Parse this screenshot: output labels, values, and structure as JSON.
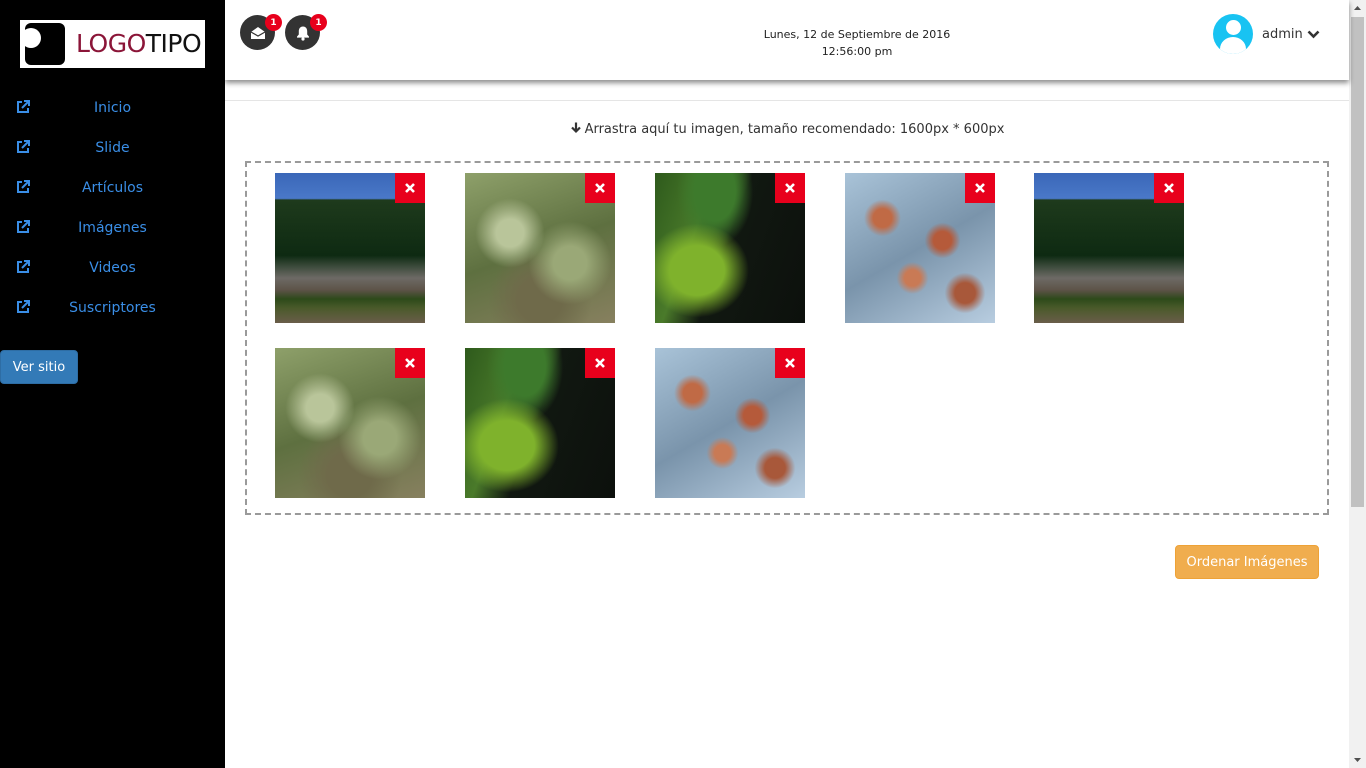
{
  "logo": {
    "part1": "LOGO",
    "part2": "TIPO"
  },
  "sidebar": {
    "items": [
      {
        "label": "Inicio",
        "icon": "external-link-icon"
      },
      {
        "label": "Slide",
        "icon": "external-link-icon"
      },
      {
        "label": "Artículos",
        "icon": "external-link-icon"
      },
      {
        "label": "Imágenes",
        "icon": "external-link-icon"
      },
      {
        "label": "Videos",
        "icon": "external-link-icon"
      },
      {
        "label": "Suscriptores",
        "icon": "external-link-icon"
      }
    ],
    "visit_site_label": "Ver sitio"
  },
  "header": {
    "messages_badge": "1",
    "notifications_badge": "1",
    "date": "Lunes, 12 de Septiembre de 2016",
    "time": "12:56:00 pm",
    "username": "admin"
  },
  "upload": {
    "hint": "Arrastra aquí tu imagen, tamaño recomendado: 1600px * 600px"
  },
  "gallery": {
    "images": [
      {
        "scene": "river"
      },
      {
        "scene": "bush"
      },
      {
        "scene": "moss"
      },
      {
        "scene": "leaves"
      },
      {
        "scene": "river"
      },
      {
        "scene": "bush"
      },
      {
        "scene": "moss"
      },
      {
        "scene": "leaves"
      }
    ]
  },
  "actions": {
    "order_label": "Ordenar Imágenes"
  },
  "colors": {
    "sidebar_bg": "#000000",
    "link": "#3a8ee6",
    "primary": "#337ab7",
    "warning": "#f0ad4e",
    "delete": "#e8001c",
    "avatar": "#18c3f2"
  }
}
